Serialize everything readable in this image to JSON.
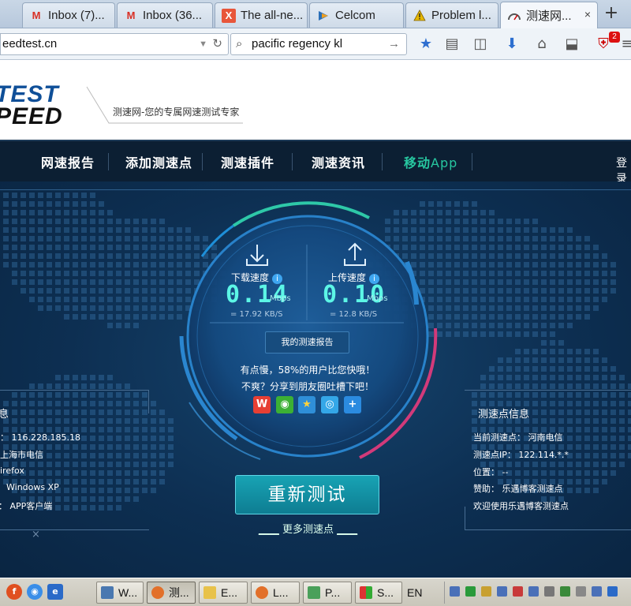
{
  "browser": {
    "tabs": [
      {
        "label": "Inbox (7)...",
        "icon": "gmail-icon",
        "color": "#d93025"
      },
      {
        "label": "Inbox (36...",
        "icon": "gmail-icon",
        "color": "#d93025"
      },
      {
        "label": "The all-ne...",
        "icon": "x-app-icon",
        "color": "#e8563a"
      },
      {
        "label": "Celcom",
        "icon": "celcom-icon",
        "color": "#2a6fb8"
      },
      {
        "label": "Problem l...",
        "icon": "warning-icon",
        "color": "#e6b800"
      },
      {
        "label": "测速网...",
        "icon": "speedometer-icon",
        "color": "#555555"
      }
    ],
    "tab_close": "×",
    "new_tab": "+",
    "address": "eedtest.cn",
    "search_value": "pacific regency  kl",
    "addon_badge": "2"
  },
  "site": {
    "logo_line1": "TEST",
    "logo_line2": "PEED",
    "slogan": "测速网-您的专属网速测试专家",
    "menu": [
      "网速报告",
      "添加测速点",
      "测速插件",
      "测速资讯"
    ],
    "menu_app_cn": "移动",
    "menu_app_en": "App",
    "login": "登录"
  },
  "speedtest": {
    "download_label": "下载速度",
    "download_value": "0.14",
    "download_unit": "Mbps",
    "download_rate": "= 17.92 KB/S",
    "upload_label": "上传速度",
    "upload_value": "0.10",
    "upload_unit": "Mbps",
    "upload_rate": "= 12.8 KB/S",
    "info_glyph": "i",
    "report_button": "我的测速报告",
    "message1": "有点慢，58%的用户比您快哦！",
    "message2": "不爽？分享到朋友圈吐槽下吧！",
    "retest_button": "重新测试",
    "more_points": "更多测速点"
  },
  "left_panel": {
    "title": "息",
    "rows": [
      {
        "key": "：",
        "value": "116.228.185.18"
      },
      {
        "key": "",
        "value": "上海市电信"
      },
      {
        "key": "",
        "value": "irefox"
      },
      {
        "key": "",
        "value": "Windows XP"
      },
      {
        "key": "：",
        "value": "APP客户端"
      }
    ],
    "close": "×"
  },
  "right_panel": {
    "title": "测速点信息",
    "rows": [
      {
        "key": "当前测速点：",
        "value": "河南电信"
      },
      {
        "key": "测速点IP：",
        "value": "122.114.*.*"
      },
      {
        "key": "位置：",
        "value": "--"
      },
      {
        "key": "赞助：",
        "value": "乐遇博客测速点"
      },
      {
        "key": "",
        "value": "欢迎使用乐遇博客测速点"
      }
    ]
  },
  "taskbar": {
    "tasks": [
      "W...",
      "测...",
      "E...",
      "L...",
      "P...",
      "S..."
    ],
    "language": "EN"
  }
}
